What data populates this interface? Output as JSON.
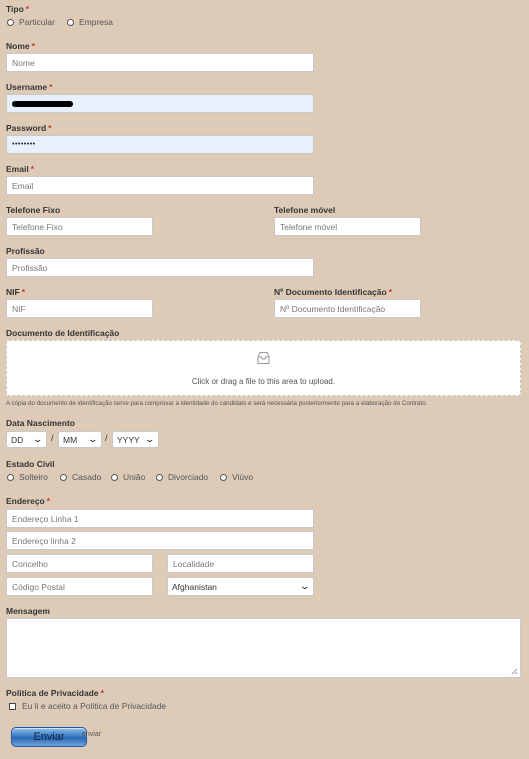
{
  "form": {
    "tipo": {
      "label": "Tipo",
      "required": "*",
      "options": [
        "Particular",
        "Empresa"
      ]
    },
    "nome": {
      "label": "Nome",
      "required": "*",
      "placeholder": "Nome"
    },
    "username": {
      "label": "Username",
      "required": "*"
    },
    "password": {
      "label": "Password",
      "required": "*",
      "value": "••••••••"
    },
    "email": {
      "label": "Email",
      "required": "*",
      "placeholder": "Email"
    },
    "telefone_fixo": {
      "label": "Telefone Fixo",
      "placeholder": "Telefone Fixo"
    },
    "telefone_movel": {
      "label": "Telefone móvel",
      "placeholder": "Telefone móvel"
    },
    "profissao": {
      "label": "Profissão",
      "placeholder": "Profissão"
    },
    "nif": {
      "label": "NIF",
      "required": "*",
      "placeholder": "NIF"
    },
    "documento_num": {
      "label": "Nº Documento Identificação",
      "required": "*",
      "placeholder": "Nº Documento Identificação"
    },
    "documento": {
      "label": "Documento de Identificação",
      "upload_text": "Click or drag a file to this area to upload.",
      "note": "A cópia do documento de identificação serve para comprovar a identidade do candidato e será necessária posteriormente para a elaboração do Contrato."
    },
    "data_nascimento": {
      "label": "Data Nascimento",
      "day": "DD",
      "month": "MM",
      "year": "YYYY",
      "separator": "/"
    },
    "estado_civil": {
      "label": "Estado Civil",
      "options": [
        "Solteiro",
        "Casado",
        "União",
        "Divorciado",
        "Viúvo"
      ]
    },
    "endereco": {
      "label": "Endereço",
      "required": "*",
      "linha1": "Endereço Linha 1",
      "linha2": "Endereço linha 2",
      "concelho": "Concelho",
      "localidade": "Localidade",
      "codigo_postal": "Código Postal",
      "pais": "Afghanistan"
    },
    "mensagem": {
      "label": "Mensagem"
    },
    "privacidade": {
      "label": "Politica de Privacidade",
      "required": "*",
      "checkbox_label": "Eu li e aceito a Politica de Privacidade"
    },
    "submit": {
      "label": "Enviar",
      "alt_text": "enviar"
    }
  },
  "icons": {
    "upload": "inbox-icon",
    "dropdown": "chevron-down-icon"
  },
  "colors": {
    "background": "#ddcbb8",
    "required": "#c0392b",
    "autofill": "#e8f0fe",
    "button": "#3a7cc6"
  }
}
